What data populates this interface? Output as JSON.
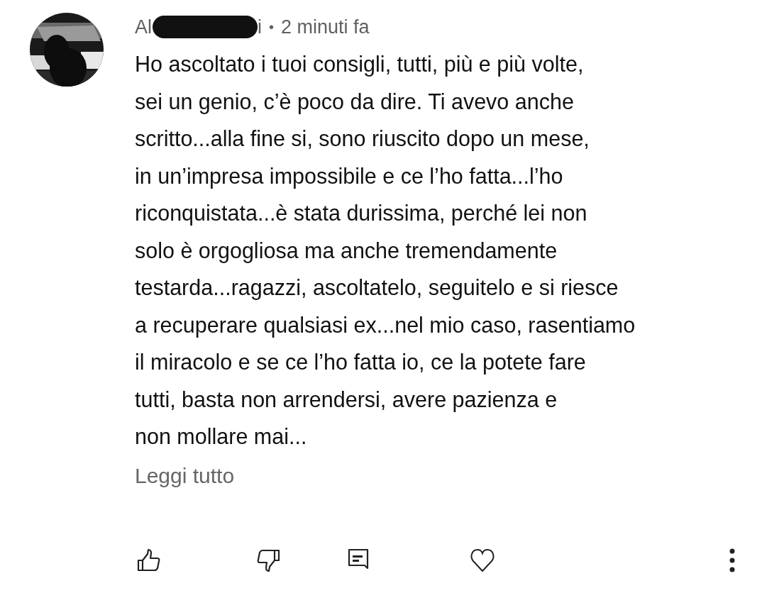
{
  "comment": {
    "author_start": "Al",
    "author_end": "i",
    "separator": "•",
    "time": "2 minuti fa",
    "lines": [
      "Ho ascoltato i tuoi consigli, tutti, più e più volte,",
      "sei un genio, c’è poco da dire. Ti avevo anche",
      "scritto...alla fine si, sono riuscito dopo un mese,",
      "in un’impresa impossibile e ce l’ho fatta...l’ho",
      "riconquistata...è stata durissima, perché lei non",
      "solo è orgogliosa ma anche tremendamente",
      "testarda...ragazzi, ascoltatelo, seguitelo e si riesce",
      "a recuperare qualsiasi ex...nel mio caso, rasentiamo",
      "il miracolo e se ce l’ho fatta io, ce la potete fare",
      "tutti, basta non arrendersi, avere pazienza e",
      "non mollare mai..."
    ],
    "read_more": "Leggi tutto"
  },
  "actions": [
    {
      "kind": "like"
    },
    {
      "kind": "dislike"
    },
    {
      "kind": "reply"
    },
    {
      "kind": "heart"
    },
    {
      "kind": "more"
    }
  ]
}
